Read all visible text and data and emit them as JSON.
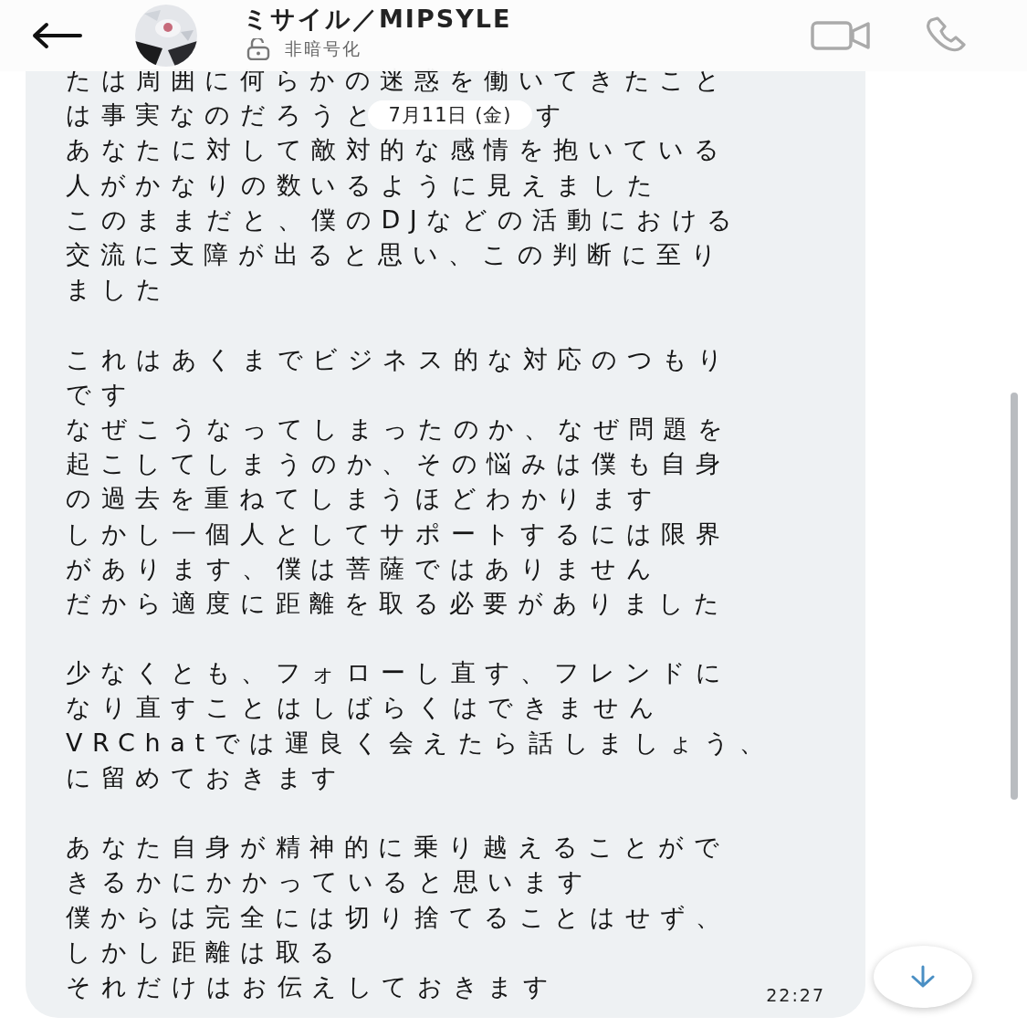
{
  "header": {
    "contact_name": "ミサイル／MIPSYLE",
    "status": "非暗号化"
  },
  "message": {
    "paragraphs": [
      [
        {
          "kind": "text",
          "text": "たは周囲に何らかの迷惑を働いてきたこと"
        },
        {
          "kind": "date_overlap",
          "text": "は事実なのだろうと",
          "date": "7月11日 (金)",
          "text_after": "す"
        },
        {
          "kind": "text",
          "text": "あなたに対して敵対的な感情を抱いている"
        },
        {
          "kind": "text",
          "text": "人がかなりの数いるように見えました"
        },
        {
          "kind": "text",
          "text": "このままだと、僕のDJなどの活動における"
        },
        {
          "kind": "text",
          "text": "交流に支障が出ると思い、この判断に至り"
        },
        {
          "kind": "text",
          "text": "ました"
        }
      ],
      [
        {
          "kind": "text",
          "text": "これはあくまでビジネス的な対応のつもり"
        },
        {
          "kind": "text",
          "text": "です"
        },
        {
          "kind": "text",
          "text": "なぜこうなってしまったのか、なぜ問題を"
        },
        {
          "kind": "text",
          "text": "起こしてしまうのか、その悩みは僕も自身"
        },
        {
          "kind": "text",
          "text": "の過去を重ねてしまうほどわかります"
        },
        {
          "kind": "text",
          "text": "しかし一個人としてサポートするには限界"
        },
        {
          "kind": "text",
          "text": "があります、僕は菩薩ではありません"
        },
        {
          "kind": "text",
          "text": "だから適度に距離を取る必要がありました"
        }
      ],
      [
        {
          "kind": "text",
          "text": "少なくとも、フォローし直す、フレンドに"
        },
        {
          "kind": "text",
          "text": "なり直すことはしばらくはできません"
        },
        {
          "kind": "text",
          "text": "VRChatでは運良く会えたら話しましょう、"
        },
        {
          "kind": "text",
          "text": "に留めておきます"
        }
      ],
      [
        {
          "kind": "text",
          "text": "あなた自身が精神的に乗り越えることがで"
        },
        {
          "kind": "text",
          "text": "きるかにかかっていると思います"
        },
        {
          "kind": "text",
          "text": "僕からは完全には切り捨てることはせず、"
        },
        {
          "kind": "text",
          "text": "しかし距離は取る"
        },
        {
          "kind": "text",
          "text": "それだけはお伝えしておきます"
        }
      ]
    ],
    "time": "22:27"
  }
}
